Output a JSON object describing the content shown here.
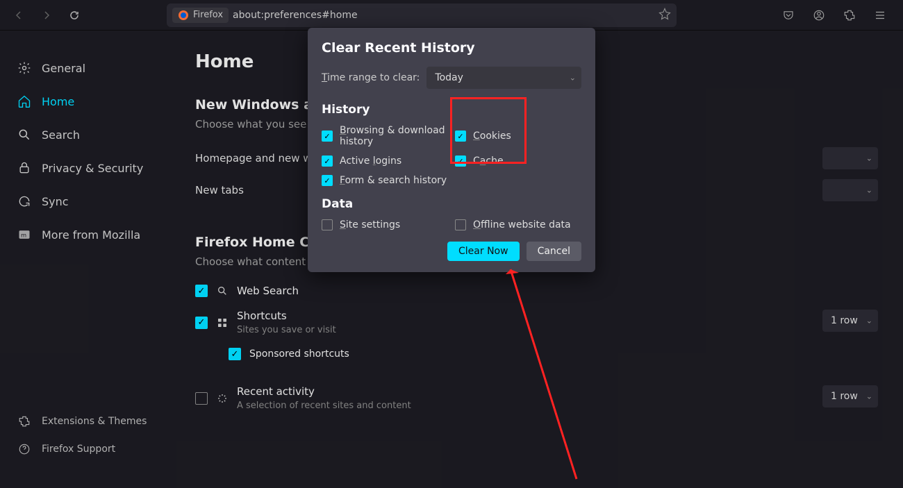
{
  "toolbar": {
    "identity_label": "Firefox",
    "url": "about:preferences#home"
  },
  "sidebar": {
    "items": [
      {
        "label": "General"
      },
      {
        "label": "Home"
      },
      {
        "label": "Search"
      },
      {
        "label": "Privacy & Security"
      },
      {
        "label": "Sync"
      },
      {
        "label": "More from Mozilla"
      }
    ],
    "bottom": [
      {
        "label": "Extensions & Themes"
      },
      {
        "label": "Firefox Support"
      }
    ]
  },
  "page": {
    "title": "Home",
    "section1_title": "New Windows and Tabs",
    "section1_desc": "Choose what you see when",
    "row_homepage": "Homepage and new windows",
    "row_newtabs": "New tabs",
    "section2_title": "Firefox Home Content",
    "section2_desc": "Choose what content you want on your Firefox Home screen.",
    "websearch": "Web Search",
    "shortcuts": "Shortcuts",
    "shortcuts_desc": "Sites you save or visit",
    "sponsored": "Sponsored shortcuts",
    "recent": "Recent activity",
    "recent_desc": "A selection of recent sites and content",
    "row_dd_1": "1 row",
    "row_dd_2": "1 row"
  },
  "dialog": {
    "title": "Clear Recent History",
    "time_label": "Time range to clear:",
    "time_value": "Today",
    "history_label": "History",
    "opt_browsing": "Browsing & download history",
    "opt_cookies": "Cookies",
    "opt_logins": "Active logins",
    "opt_cache": "Cache",
    "opt_form": "Form & search history",
    "data_label": "Data",
    "opt_sitesettings": "Site settings",
    "opt_offline": "Offline website data",
    "btn_clear": "Clear Now",
    "btn_cancel": "Cancel"
  }
}
